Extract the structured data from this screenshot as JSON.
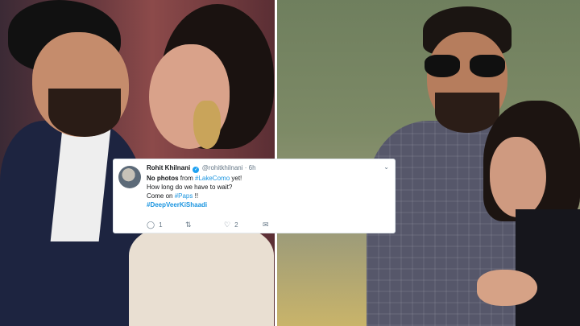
{
  "tweet": {
    "display_name": "Rohit Khilnani",
    "handle": "@rohitkhilnani",
    "separator": "·",
    "time": "6h",
    "line1_start": "No photos",
    "line1_mid": " from ",
    "line1_tag": "#LakeComo",
    "line1_end": " yet!",
    "line2": "How long do we have to wait?",
    "line3_start": "Come on ",
    "line3_tag": "#Paps",
    "line3_end": " !!",
    "line4_tag": "#DeepVeerKiShaadi",
    "reply_count": "1",
    "retweet_count": "",
    "like_count": "2",
    "icons": {
      "verified": "verified-badge-icon",
      "caret": "chevron-down-icon",
      "reply": "reply-icon",
      "retweet": "retweet-icon",
      "like": "heart-icon",
      "message": "envelope-icon"
    }
  },
  "colors": {
    "link": "#1b95e0",
    "verified": "#1da1f2",
    "muted": "#657786"
  }
}
